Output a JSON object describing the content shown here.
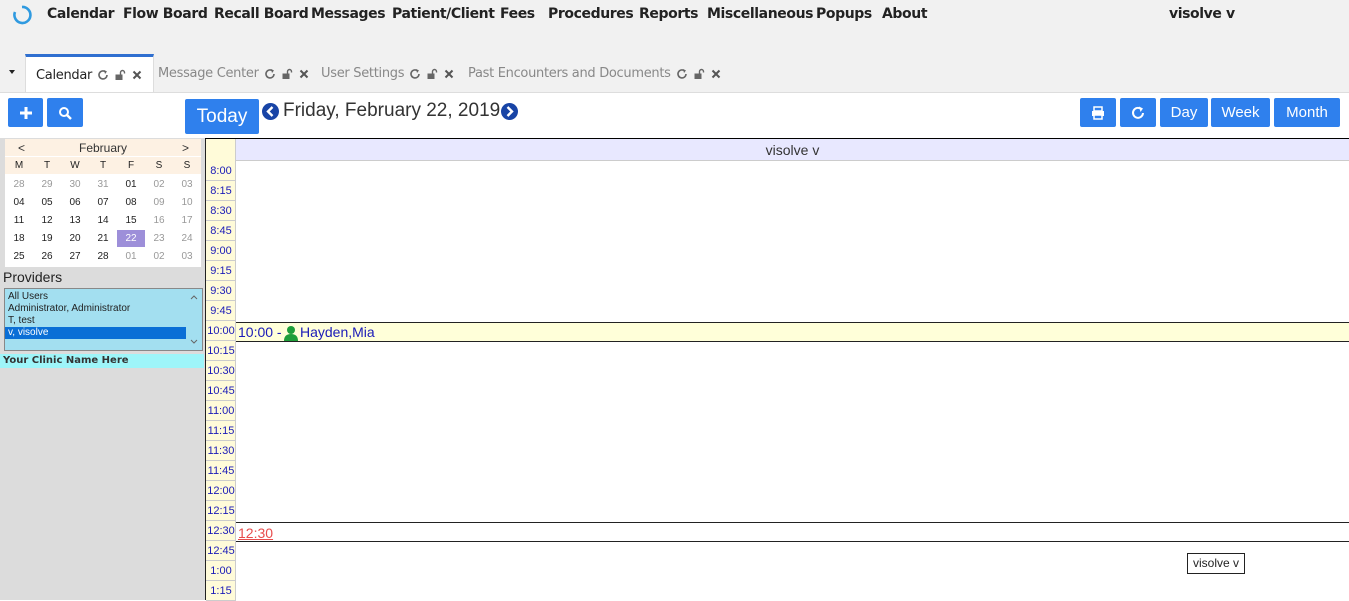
{
  "menu": {
    "items": [
      "Calendar",
      "Flow Board",
      "Recall Board",
      "Messages",
      "Patient/Client",
      "Fees",
      "Procedures",
      "Reports",
      "Miscellaneous",
      "Popups",
      "About"
    ],
    "user": "visolve v"
  },
  "tabs": [
    {
      "label": "Calendar",
      "active": true
    },
    {
      "label": "Message Center",
      "active": false
    },
    {
      "label": "User Settings",
      "active": false
    },
    {
      "label": "Past Encounters and Documents",
      "active": false
    }
  ],
  "toolbar": {
    "today_label": "Today",
    "date_title": "Friday, February 22, 2019",
    "view_day": "Day",
    "view_week": "Week",
    "view_month": "Month"
  },
  "minical": {
    "month": "February",
    "prev": "<",
    "next": ">",
    "dow": [
      "M",
      "T",
      "W",
      "T",
      "F",
      "S",
      "S"
    ],
    "weeks": [
      [
        "28",
        "29",
        "30",
        "31",
        "01",
        "02",
        "03"
      ],
      [
        "04",
        "05",
        "06",
        "07",
        "08",
        "09",
        "10"
      ],
      [
        "11",
        "12",
        "13",
        "14",
        "15",
        "16",
        "17"
      ],
      [
        "18",
        "19",
        "20",
        "21",
        "22",
        "23",
        "24"
      ],
      [
        "25",
        "26",
        "27",
        "28",
        "01",
        "02",
        "03"
      ]
    ],
    "selected": "22"
  },
  "providers": {
    "label": "Providers",
    "items": [
      "All Users",
      "Administrator, Administrator",
      "T, test",
      "v, visolve"
    ],
    "selected_index": 3
  },
  "clinic_name": "Your Clinic Name Here",
  "schedule": {
    "provider": "visolve v",
    "times": [
      "8:00",
      "8:15",
      "8:30",
      "8:45",
      "9:00",
      "9:15",
      "9:30",
      "9:45",
      "10:00",
      "10:15",
      "10:30",
      "10:45",
      "11:00",
      "11:15",
      "11:30",
      "11:45",
      "12:00",
      "12:15",
      "12:30",
      "12:45",
      "1:00",
      "1:15"
    ],
    "appointment": {
      "time": "10:00 -",
      "patient": "Hayden,Mia"
    },
    "slot_link": "12:30",
    "tooltip": "visolve v"
  },
  "colors": {
    "accent": "#2f80ed",
    "selected_day": "#9d8fd9",
    "appt_bg": "#ffffd9",
    "time_text": "#1a1ab8"
  }
}
